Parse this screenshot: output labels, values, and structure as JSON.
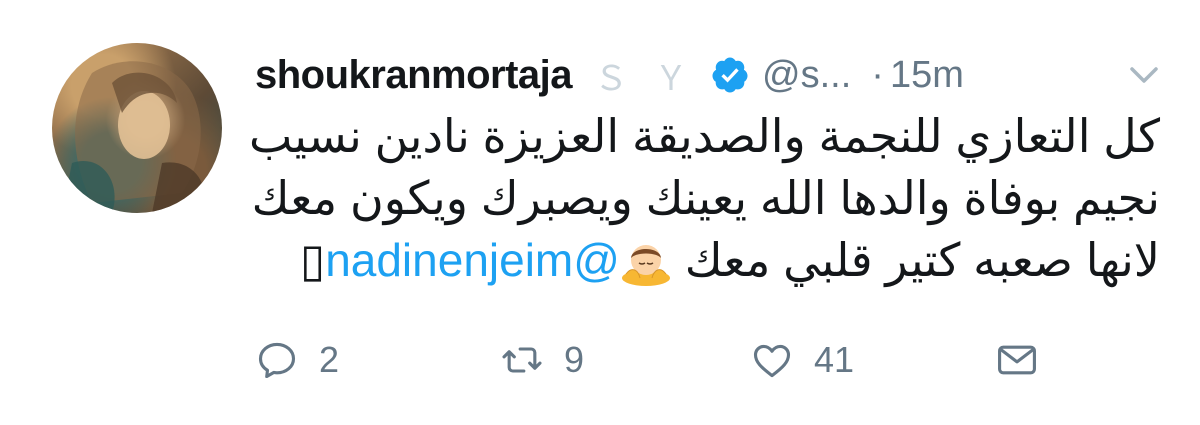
{
  "tweet": {
    "display_name": "shoukranmortaja",
    "name_glyphs": [
      "Ｓ",
      "Ｙ"
    ],
    "handle": "@s...",
    "separator": "·",
    "time": "15m",
    "text_lines": [
      "كل التعازي للنجمة والصديقة العزيزة نادين نسيب",
      "نجيم بوفاة والدها الله يعينك ويصبرك ويكون معك",
      "لانها صعبه كتير قلبي معك"
    ],
    "mention": "@nadinenjeim",
    "trailing_glyph": "▯",
    "emoji": "person-bowing-emoji",
    "actions": {
      "reply_count": "2",
      "retweet_count": "9",
      "like_count": "41"
    }
  },
  "colors": {
    "text": "#14171a",
    "secondary": "#657786",
    "link": "#1da1f2",
    "verified": "#1da1f2",
    "muted_glyph": "#ccd6dd"
  },
  "icons": [
    "reply-icon",
    "retweet-icon",
    "like-icon",
    "direct-message-icon",
    "verified-badge-icon",
    "chevron-down-icon"
  ]
}
